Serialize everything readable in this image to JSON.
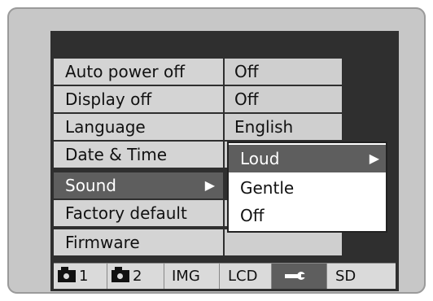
{
  "menu": {
    "items": [
      {
        "label": "Auto power off",
        "value": "Off"
      },
      {
        "label": "Display off",
        "value": "Off"
      },
      {
        "label": "Language",
        "value": "English"
      },
      {
        "label": "Date & Time",
        "value": ""
      },
      {
        "label": "Sound",
        "value": "",
        "arrow": "▶"
      },
      {
        "label": "Factory default",
        "value": ""
      },
      {
        "label": "Firmware",
        "value": ""
      }
    ]
  },
  "popup": {
    "options": [
      {
        "label": "Loud",
        "arrow": "▶"
      },
      {
        "label": "Gentle"
      },
      {
        "label": "Off"
      }
    ]
  },
  "tabs": [
    {
      "label": "1",
      "icon": "camera-icon"
    },
    {
      "label": "2",
      "icon": "camera-icon"
    },
    {
      "label": "IMG"
    },
    {
      "label": "LCD"
    },
    {
      "label": "",
      "icon": "wrench-icon"
    },
    {
      "label": "SD"
    }
  ]
}
